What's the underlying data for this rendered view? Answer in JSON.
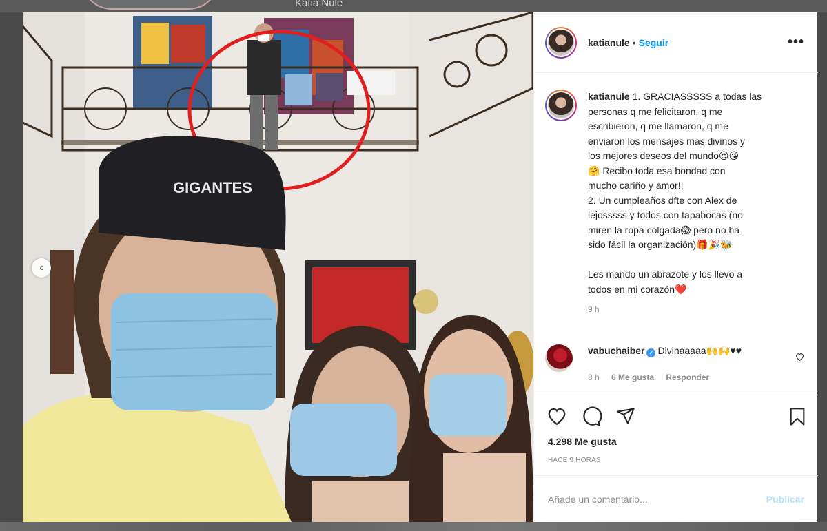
{
  "background": {
    "partial_name": "Katia Nule"
  },
  "post": {
    "username": "katianule",
    "separator": "•",
    "follow_label": "Seguir",
    "more_label": "•••",
    "caption": {
      "username": "katianule",
      "lines": [
        "1. GRACIASSSSS a todas las",
        "personas q me felicitaron, q me",
        "escribieron, q me llamaron, q me",
        "enviaron los mensajes más divinos y",
        "los mejores deseos del mundo😍😘",
        "🤗 Recibo toda esa bondad con",
        "mucho cariño y amor!!",
        "2. Un cumpleaños dfte con Alex de",
        "lejosssss y todos con tapabocas (no",
        "miren la ropa colgada😱 pero no ha",
        "sido fácil la organización)🎁🎉🐝",
        "",
        "Les mando un abrazote y los llevo a",
        "todos en mi corazón❤️"
      ],
      "time": "9 h"
    },
    "comment": {
      "username": "vabuchaiber",
      "text": "Divinaaaaa🙌🙌♥♥",
      "time": "8 h",
      "likes": "6 Me gusta",
      "reply": "Responder"
    },
    "likes_count": "4.298 Me gusta",
    "posted_ago": "HACE 9 HORAS",
    "comment_placeholder": "Añade un comentario...",
    "publish_label": "Publicar"
  },
  "photo": {
    "cap_text": "GIGANTES"
  },
  "icons": {
    "like": "heart-outline-icon",
    "comment": "speech-bubble-icon",
    "share": "paper-plane-icon",
    "save": "bookmark-icon",
    "comment_like": "small-heart-icon",
    "prev": "chevron-left-icon"
  },
  "colors": {
    "link_blue": "#0095f6",
    "publish_disabled": "#b2dffc",
    "verified_blue": "#3897f0",
    "annotation_red": "#e02020"
  }
}
